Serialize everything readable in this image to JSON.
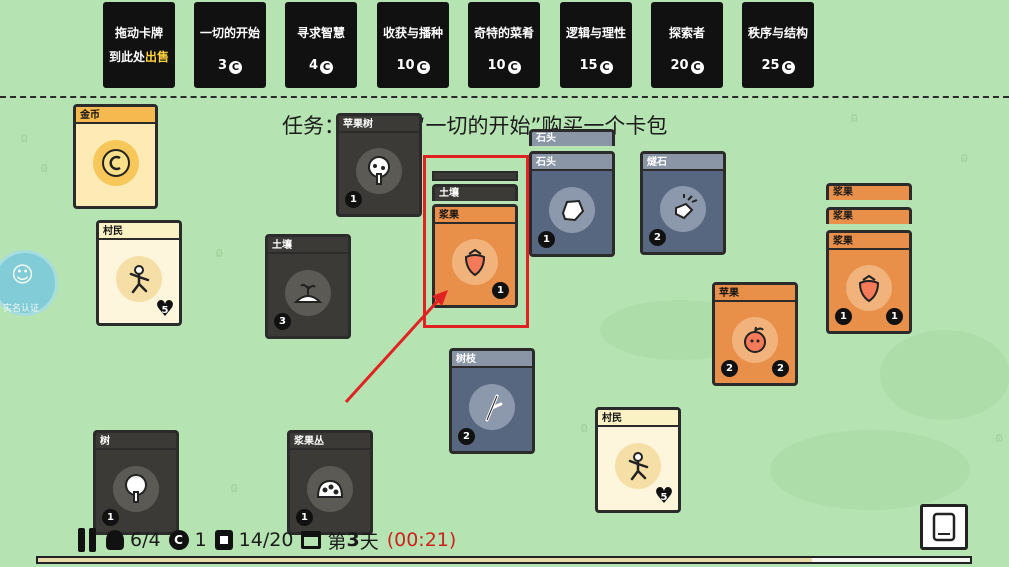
{
  "sell_slot": {
    "line1": "拖动卡牌",
    "line2_prefix": "到此处",
    "line2_highlight": "出售"
  },
  "packs": [
    {
      "name": "一切的开始",
      "price": "3"
    },
    {
      "name": "寻求智慧",
      "price": "4"
    },
    {
      "name": "收获与播种",
      "price": "10"
    },
    {
      "name": "奇特的菜肴",
      "price": "10"
    },
    {
      "name": "逻辑与理性",
      "price": "15"
    },
    {
      "name": "探索者",
      "price": "20"
    },
    {
      "name": "秩序与结构",
      "price": "25"
    }
  ],
  "coin_glyph": "C",
  "quest_text": "任务：      上角的“一切的开始”购买一个卡包",
  "cards": {
    "gold": {
      "title": "金币",
      "art": "coin-icon"
    },
    "villager1": {
      "title": "村民",
      "art": "villager-icon",
      "value": "5"
    },
    "applebush": {
      "title": "苹果树",
      "art": "apple-tree-icon",
      "value": "1"
    },
    "soil1": {
      "title": "土壤",
      "art": "soil-icon",
      "value": "3"
    },
    "tree": {
      "title": "树",
      "art": "tree-icon",
      "value": "1"
    },
    "berrybush": {
      "title": "浆果丛",
      "art": "berry-bush-icon",
      "value": "1"
    },
    "stack_soil": {
      "title": "土壤"
    },
    "berry_sel": {
      "title": "浆果",
      "art": "strawberry-icon",
      "value": "1"
    },
    "stone_stack": {
      "title": "石头"
    },
    "stone": {
      "title": "石头",
      "art": "stone-icon",
      "value": "1"
    },
    "flint": {
      "title": "燧石",
      "art": "flint-icon",
      "value": "2"
    },
    "berries_stack1": {
      "title": "浆果"
    },
    "berries_stack2": {
      "title": "浆果"
    },
    "berries": {
      "title": "浆果",
      "art": "strawberry-icon",
      "value_left": "1",
      "value_right": "1"
    },
    "apple": {
      "title": "苹果",
      "art": "apple-icon",
      "value_left": "2",
      "value_right": "2"
    },
    "stick": {
      "title": "树枝",
      "art": "stick-icon",
      "value": "2"
    },
    "villager2": {
      "title": "村民",
      "art": "villager-icon",
      "value": "5"
    }
  },
  "hud": {
    "food": "6/4",
    "coins": "1",
    "cards": "14/20",
    "day_prefix": "第",
    "day_num": "3",
    "day_suffix": "天",
    "timer": "(00:21)",
    "day_progress": 0.83
  },
  "verify_label": "实名认证",
  "colors": {
    "highlight": "#e02222",
    "background": "#b5e3b1",
    "timer": "#d01f1f"
  }
}
